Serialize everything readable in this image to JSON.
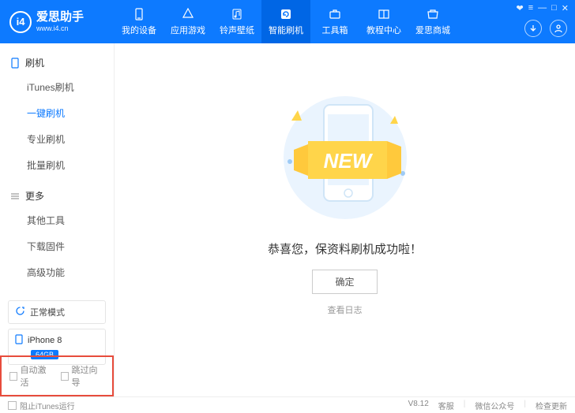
{
  "header": {
    "logo_text": "爱思助手",
    "logo_sub": "www.i4.cn",
    "logo_badge": "i4",
    "nav": [
      {
        "label": "我的设备",
        "icon": "phone"
      },
      {
        "label": "应用游戏",
        "icon": "apps"
      },
      {
        "label": "铃声壁纸",
        "icon": "music"
      },
      {
        "label": "智能刷机",
        "icon": "refresh",
        "active": true
      },
      {
        "label": "工具箱",
        "icon": "toolbox"
      },
      {
        "label": "教程中心",
        "icon": "book"
      },
      {
        "label": "爱思商城",
        "icon": "shop"
      }
    ],
    "window_controls": [
      "❤",
      "≡",
      "—",
      "□",
      "✕"
    ]
  },
  "sidebar": {
    "sections": [
      {
        "title": "刷机",
        "icon": "phone",
        "items": [
          "iTunes刷机",
          "一键刷机",
          "专业刷机",
          "批量刷机"
        ],
        "active_index": 1
      },
      {
        "title": "更多",
        "icon": "menu",
        "items": [
          "其他工具",
          "下载固件",
          "高级功能"
        ]
      }
    ],
    "mode": {
      "label": "正常模式"
    },
    "device": {
      "name": "iPhone 8",
      "storage": "64GB"
    },
    "options": [
      "自动激活",
      "跳过向导"
    ]
  },
  "content": {
    "illus_text": "NEW",
    "success": "恭喜您，保资料刷机成功啦！",
    "confirm": "确定",
    "log": "查看日志"
  },
  "footer": {
    "left": "阻止iTunes运行",
    "version": "V8.12",
    "links": [
      "客服",
      "微信公众号",
      "检查更新"
    ]
  }
}
